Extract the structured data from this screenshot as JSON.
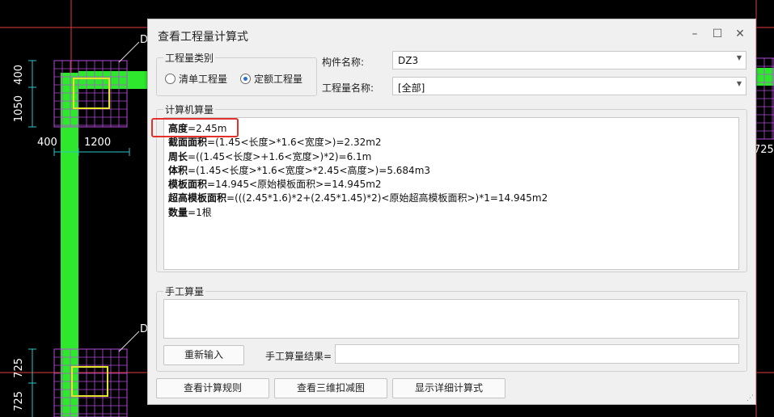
{
  "cad": {
    "dim_labels": [
      "400",
      "1050",
      "400",
      "1200",
      "725",
      "725",
      "725",
      "D",
      "D"
    ]
  },
  "dialog": {
    "title": "查看工程量计算式",
    "minimize_icon": "minimize-icon",
    "maximize_icon": "maximize-icon",
    "close_icon": "close-icon",
    "quantity_type": {
      "label": "工程量类别",
      "options": [
        "清单工程量",
        "定额工程量"
      ],
      "selected": "定额工程量"
    },
    "component_name": {
      "label": "构件名称:",
      "value": "DZ3"
    },
    "quantity_name": {
      "label": "工程量名称:",
      "value": "[全部]"
    },
    "computer_calc": {
      "label": "计算机算量",
      "lines": [
        {
          "key": "高度",
          "expr": "=2.45m"
        },
        {
          "key": "截面面积",
          "expr": "=(1.45<长度>*1.6<宽度>)=2.32m2"
        },
        {
          "key": "周长",
          "expr": "=((1.45<长度>+1.6<宽度>)*2)=6.1m"
        },
        {
          "key": "体积",
          "expr": "=(1.45<长度>*1.6<宽度>*2.45<高度>)=5.684m3"
        },
        {
          "key": "模板面积",
          "expr": "=14.945<原始模板面积>=14.945m2"
        },
        {
          "key": "超高模板面积",
          "expr": "=(((2.45*1.6)*2+(2.45*1.45)*2)<原始超高模板面积>)*1=14.945m2"
        },
        {
          "key": "数量",
          "expr": "=1根"
        }
      ]
    },
    "manual_calc": {
      "label": "手工算量",
      "reset_label": "重新输入",
      "result_label": "手工算量结果=",
      "result_value": ""
    },
    "footer": {
      "rules_label": "查看计算规则",
      "view3d_label": "查看三维扣减图",
      "detail_label": "显示详细计算式"
    },
    "colors": {
      "highlight": "#e4312b",
      "radio_accent": "#2a6fd6"
    }
  }
}
